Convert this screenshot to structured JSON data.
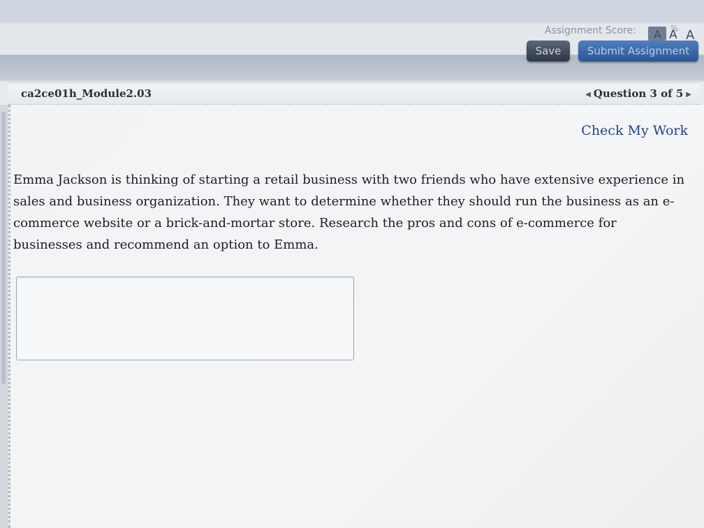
{
  "header": {
    "assignment_score_label": "Assignment Score:",
    "score_percent": "%",
    "font_size_controls": [
      "A",
      "A",
      "A"
    ],
    "save_label": "Save",
    "submit_label": "Submit Assignment"
  },
  "module_bar": {
    "module_name": "ca2ce01h_Module2.03",
    "question_nav": "Question 3 of 5"
  },
  "main": {
    "check_my_work": "Check My Work",
    "question_text": "Emma Jackson is thinking of starting a retail business with two friends who have extensive experience in sales and business organization. They want to determine whether they should run the business as an e-commerce website or a brick-and-mortar store. Research the pros and cons of e-commerce for businesses and recommend an option to Emma.",
    "answer_value": ""
  },
  "colors": {
    "link": "#27408b",
    "submit_button": "#2a5694",
    "save_button": "#2e3745"
  },
  "icons": [
    "chevron-left-icon",
    "chevron-right-icon"
  ]
}
